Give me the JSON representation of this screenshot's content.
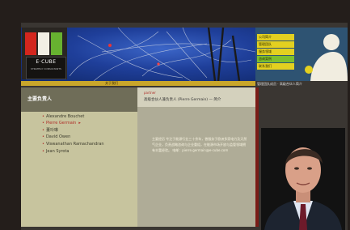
{
  "header": {
    "logo_text": "E·CUBE",
    "logo_subtext": "STRATEGY CONSULTANTS",
    "strip_label": "关于我们",
    "menu_items": [
      "公司简介",
      "管理团队",
      "服务领域",
      "咨询案例",
      "联系我们"
    ],
    "menu_caption": "管理团队成员 · 高级合伙人简介"
  },
  "left": {
    "title": "主要负责人",
    "names": [
      "Alexandre Bouchet",
      "Pierre Germain",
      "董玲琳",
      "David Owen",
      "Viswanathan Ramachandran",
      "Jean Syrota"
    ]
  },
  "middle": {
    "subtitle": "partner",
    "heading": "高级合伙人兼负责人 (Pierre Germain) — 简介",
    "body": "主要经历 专注于能源行业三十余年，曾服务于欧洲多家电力及天然气企业，负责战略咨询与企业重组，在能源市场开放与监管领域拥有丰富经验。 电邮：pierre.germain@e-cube.com"
  },
  "colors": {
    "accent": "#c9a62b",
    "menu_yellow": "#e3d020",
    "brand_red": "#7a1c17"
  }
}
